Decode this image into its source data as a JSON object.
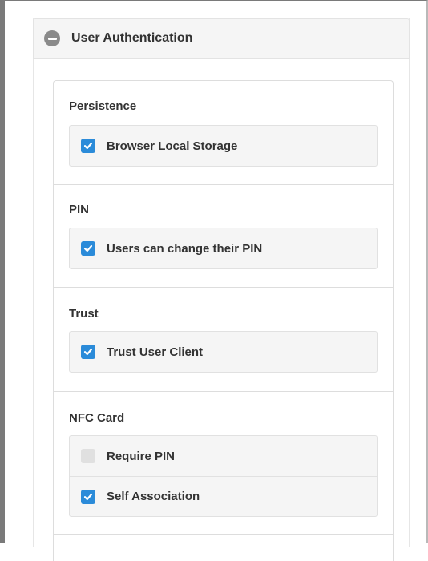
{
  "section": {
    "title": "User Authentication",
    "icon": "minus-circle-icon"
  },
  "groups": [
    {
      "label": "Persistence",
      "options": [
        {
          "label": "Browser Local Storage",
          "checked": true
        }
      ]
    },
    {
      "label": "PIN",
      "options": [
        {
          "label": "Users can change their PIN",
          "checked": true
        }
      ]
    },
    {
      "label": "Trust",
      "options": [
        {
          "label": "Trust User Client",
          "checked": true
        }
      ]
    },
    {
      "label": "NFC Card",
      "options": [
        {
          "label": "Require PIN",
          "checked": false
        },
        {
          "label": "Self Association",
          "checked": true
        }
      ]
    }
  ],
  "colors": {
    "checked": "#2b8bd9",
    "unchecked": "#e0e0e0",
    "header_bg": "#f5f5f5",
    "option_bg": "#f5f5f5"
  }
}
